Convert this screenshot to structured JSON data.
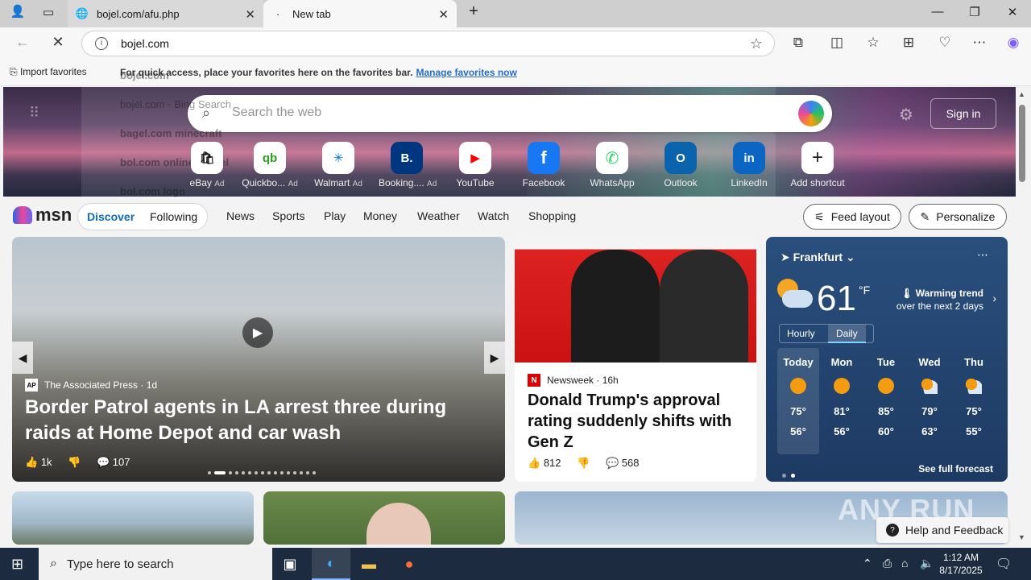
{
  "browser": {
    "tabs": [
      {
        "title": "bojel.com/afu.php",
        "active": false
      },
      {
        "title": "New tab",
        "active": true
      }
    ],
    "address": "bojel.com",
    "favorites_bar": {
      "import_label": "Import favorites",
      "message": "For quick access, place your favorites here on the favorites bar.",
      "manage_link": "Manage favorites now"
    },
    "suggestions": [
      {
        "text": "bojel.com",
        "suffix": ""
      },
      {
        "text": "bojel.com",
        "suffix": " - Bing Search"
      },
      {
        "text": "bagel.com minecraft",
        "suffix": ""
      },
      {
        "text": "bol.com online winkel",
        "suffix": ""
      },
      {
        "text": "bol.com logo",
        "suffix": ""
      }
    ]
  },
  "msn": {
    "search_placeholder": "Search the web",
    "sign_in": "Sign in",
    "shortcuts": [
      {
        "label": "eBay",
        "ad": "Ad",
        "glyph": "🛍"
      },
      {
        "label": "Quickbo...",
        "ad": "Ad",
        "glyph": "qb"
      },
      {
        "label": "Walmart",
        "ad": "Ad",
        "glyph": "✳"
      },
      {
        "label": "Booking....",
        "ad": "Ad",
        "glyph": "B."
      },
      {
        "label": "YouTube",
        "ad": "",
        "glyph": "▶"
      },
      {
        "label": "Facebook",
        "ad": "",
        "glyph": "f"
      },
      {
        "label": "WhatsApp",
        "ad": "",
        "glyph": "✆"
      },
      {
        "label": "Outlook",
        "ad": "",
        "glyph": "O"
      },
      {
        "label": "LinkedIn",
        "ad": "",
        "glyph": "in"
      },
      {
        "label": "Add shortcut",
        "ad": "",
        "glyph": "+"
      }
    ],
    "logo": "msn",
    "pill": {
      "discover": "Discover",
      "following": "Following"
    },
    "nav": [
      "News",
      "Sports",
      "Play",
      "Money",
      "Weather",
      "Watch",
      "Shopping"
    ],
    "feed_layout": "Feed layout",
    "personalize": "Personalize"
  },
  "main_story": {
    "source": "The Associated Press",
    "age": "1d",
    "headline": "Border Patrol agents in LA arrest three during raids at Home Depot and car wash",
    "likes": "1k",
    "comments": "107"
  },
  "side_story": {
    "source": "Newsweek",
    "age": "16h",
    "headline": "Donald Trump's approval rating suddenly shifts with Gen Z",
    "likes": "812",
    "comments": "568"
  },
  "weather": {
    "location": "Frankfurt",
    "temp": "61",
    "unit": "°F",
    "trend_title": "Warming trend",
    "trend_sub": "over the next 2 days",
    "tab_hourly": "Hourly",
    "tab_daily": "Daily",
    "days": [
      {
        "name": "Today",
        "hi": "75°",
        "lo": "56°",
        "icon": "sunny"
      },
      {
        "name": "Mon",
        "hi": "81°",
        "lo": "56°",
        "icon": "sunny"
      },
      {
        "name": "Tue",
        "hi": "85°",
        "lo": "60°",
        "icon": "sunny"
      },
      {
        "name": "Wed",
        "hi": "79°",
        "lo": "63°",
        "icon": "partly-cloudy"
      },
      {
        "name": "Thu",
        "hi": "75°",
        "lo": "55°",
        "icon": "partly-cloudy"
      }
    ],
    "see_full": "See full forecast"
  },
  "watermark": "ANY RUN",
  "help_feedback": "Help and Feedback",
  "taskbar": {
    "search_placeholder": "Type here to search",
    "time": "1:12 AM",
    "date": "8/17/2025"
  }
}
